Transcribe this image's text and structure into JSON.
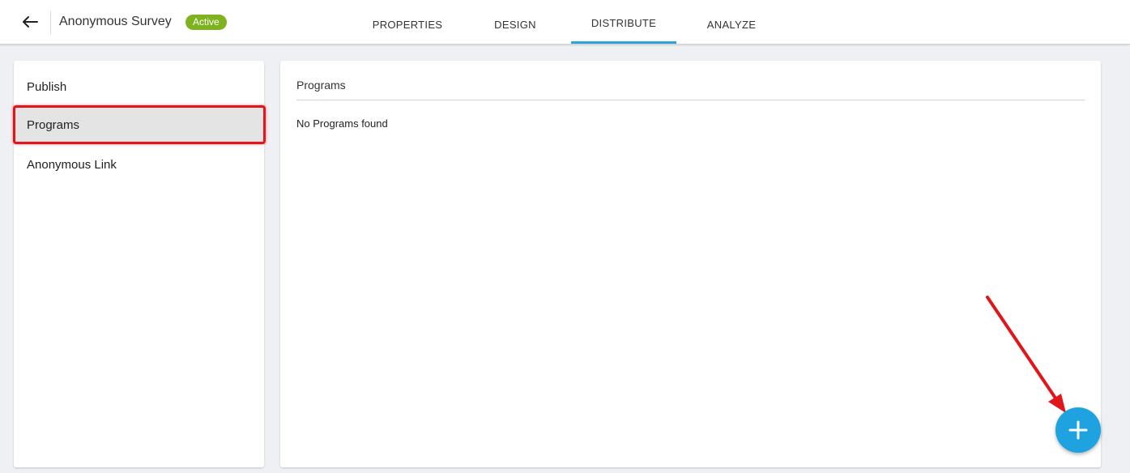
{
  "header": {
    "survey_title": "Anonymous Survey",
    "status_badge": "Active",
    "status_color": "#7fb21f",
    "back_icon": "arrow-left-icon",
    "tabs": [
      {
        "label": "PROPERTIES",
        "active": false
      },
      {
        "label": "DESIGN",
        "active": false
      },
      {
        "label": "DISTRIBUTE",
        "active": true
      },
      {
        "label": "ANALYZE",
        "active": false
      }
    ],
    "accent_color": "#2da5dc"
  },
  "sidebar": {
    "items": [
      {
        "label": "Publish",
        "selected": false
      },
      {
        "label": "Programs",
        "selected": true
      },
      {
        "label": "Anonymous Link",
        "selected": false
      }
    ]
  },
  "main": {
    "title": "Programs",
    "empty_message": "No Programs found"
  },
  "fab": {
    "icon": "plus-icon",
    "color": "#1fa3e0"
  },
  "annotation": {
    "highlight_color": "#e0161a",
    "arrow_icon": "red-arrow-annotation"
  }
}
